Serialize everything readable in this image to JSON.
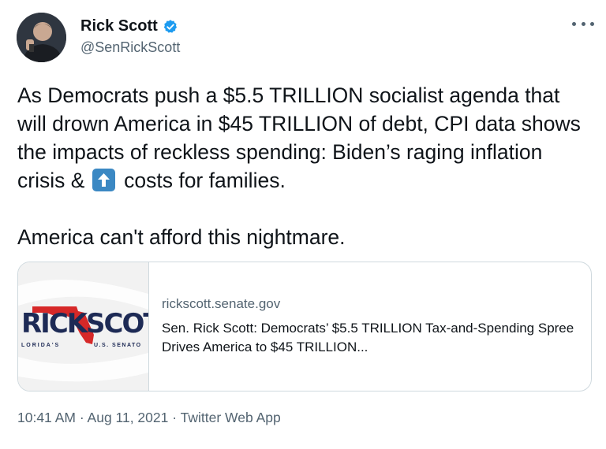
{
  "author": {
    "name": "Rick Scott",
    "handle": "@SenRickScott",
    "verified_icon": "verified-badge-icon"
  },
  "more_icon": "more-options-icon",
  "tweet": {
    "text_part1": "As Democrats push a $5.5 TRILLION socialist agenda that will drown America in $45 TRILLION of debt, CPI data shows the impacts of reckless spending: Biden’s raging inflation crisis & ",
    "emoji_name": "up-arrow-emoji",
    "text_part2": " costs for families.",
    "text_line2": "America can't afford this nightmare."
  },
  "card": {
    "thumb_rick": "RICK",
    "thumb_scott": "SCOTT",
    "thumb_sub_left": "LORIDA'S",
    "thumb_sub_right": "U.S. SENATO",
    "domain": "rickscott.senate.gov",
    "title": "Sen. Rick Scott: Democrats’ $5.5 TRILLION Tax-and-Spending Spree Drives America to $45 TRILLION..."
  },
  "meta": {
    "time": "10:41 AM",
    "date": "Aug 11, 2021",
    "source": "Twitter Web App",
    "separator": " · "
  },
  "colors": {
    "verified": "#1d9bf0",
    "secondary_text": "#536471",
    "primary_text": "#0f1419",
    "emoji_bg": "#3b88c3",
    "florida_red": "#d62828",
    "logo_navy": "#1d2a55"
  }
}
